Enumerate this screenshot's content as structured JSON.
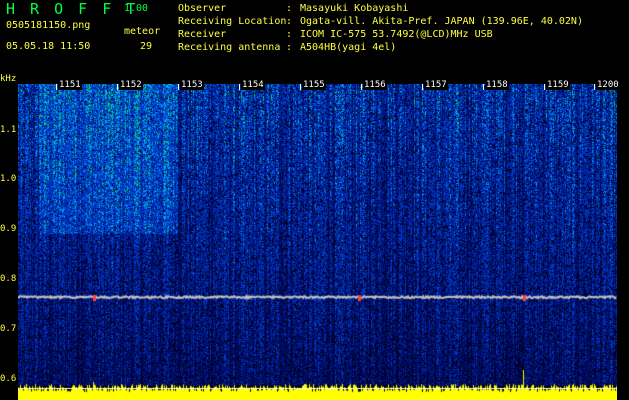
{
  "app": {
    "name": "H R O F F T",
    "version": "1.00"
  },
  "file": {
    "name": "0505181150.png",
    "datetime": "05.05.18 11:50"
  },
  "meteor": {
    "label": "meteor",
    "count": "29"
  },
  "info": [
    {
      "key": "Observer",
      "value": "Masayuki Kobayashi"
    },
    {
      "key": "Receiving Location",
      "value": "Ogata-vill. Akita-Pref. JAPAN (139.96E, 40.02N)"
    },
    {
      "key": "Receiver",
      "value": "ICOM IC-575 53.7492(@LCD)MHz USB"
    },
    {
      "key": "Receiving antenna",
      "value": "A504HB(yagi 4el)"
    }
  ],
  "spectrogram": {
    "y_unit": "kHz",
    "y_ticks": [
      "1.1",
      "1.0",
      "0.9",
      "0.8",
      "0.7",
      "0.6"
    ],
    "x_ticks": [
      "1151",
      "1152",
      "1153",
      "1154",
      "1155",
      "1156",
      "1157",
      "1158",
      "1159",
      "1200"
    ],
    "carrier_khz": 0.78,
    "y_range_khz": [
      0.6,
      1.2
    ],
    "colors": {
      "low": "#001aa0",
      "mid": "#0090ff",
      "high": "#00ff60",
      "peak": "#ff4040",
      "amplitude": "#ffff00"
    }
  }
}
